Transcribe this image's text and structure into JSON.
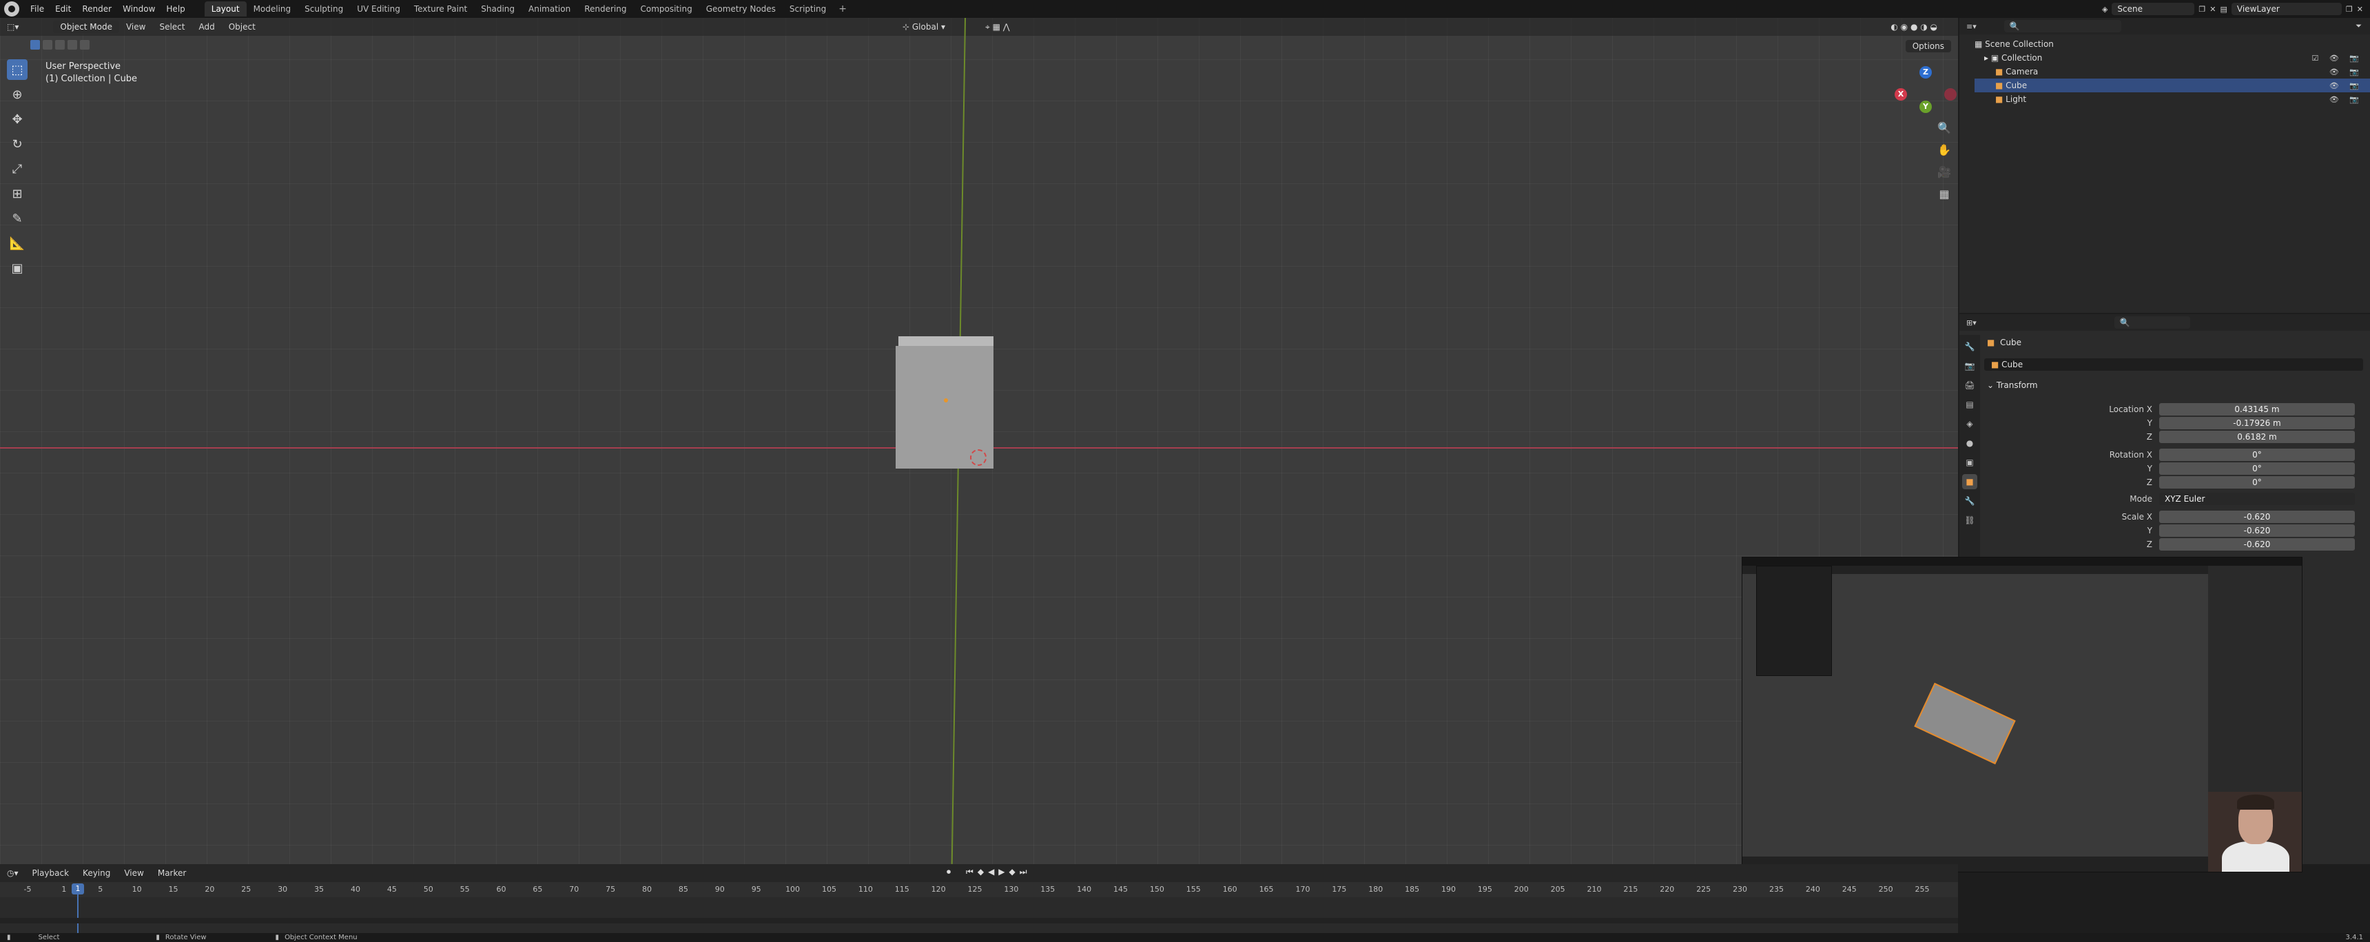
{
  "topbar": {
    "menus": [
      "File",
      "Edit",
      "Render",
      "Window",
      "Help"
    ],
    "workspaces": [
      "Layout",
      "Modeling",
      "Sculpting",
      "UV Editing",
      "Texture Paint",
      "Shading",
      "Animation",
      "Rendering",
      "Compositing",
      "Geometry Nodes",
      "Scripting"
    ],
    "active_workspace": "Layout",
    "scene_label": "Scene",
    "viewlayer_label": "ViewLayer"
  },
  "viewport": {
    "mode": "Object Mode",
    "menus": [
      "View",
      "Select",
      "Add",
      "Object"
    ],
    "orientation": "Global",
    "options_label": "Options",
    "info_line1": "User Perspective",
    "info_line2": "(1) Collection | Cube"
  },
  "outliner": {
    "root": "Scene Collection",
    "collection": "Collection",
    "items": [
      "Camera",
      "Cube",
      "Light"
    ]
  },
  "properties": {
    "object_name": "Cube",
    "data_name": "Cube",
    "panel_title": "Transform",
    "location_label": "Location X",
    "location": [
      "0.43145 m",
      "-0.17926 m",
      "0.6182 m"
    ],
    "rotation_label": "Rotation X",
    "rotation": [
      "0°",
      "0°",
      "0°"
    ],
    "mode_label": "Mode",
    "mode_value": "XYZ Euler",
    "scale_label": "Scale X",
    "scale": [
      "-0.620",
      "-0.620",
      "-0.620"
    ],
    "y_label": "Y",
    "z_label": "Z"
  },
  "timeline": {
    "menus": [
      "Playback",
      "Keying",
      "View",
      "Marker"
    ],
    "current_frame": "1",
    "ticks": [
      "-5",
      "1",
      "5",
      "10",
      "15",
      "20",
      "25",
      "30",
      "35",
      "40",
      "45",
      "50",
      "55",
      "60",
      "65",
      "70",
      "75",
      "80",
      "85",
      "90",
      "95",
      "100",
      "105",
      "110",
      "115",
      "120",
      "125",
      "130",
      "135",
      "140",
      "145",
      "150",
      "155",
      "160",
      "165",
      "170",
      "175",
      "180",
      "185",
      "190",
      "195",
      "200",
      "205",
      "210",
      "215",
      "220",
      "225",
      "230",
      "235",
      "240",
      "245",
      "250",
      "255"
    ]
  },
  "statusbar": {
    "select": "Select",
    "rotate": "Rotate View",
    "context": "Object Context Menu",
    "version": "3.4.1"
  }
}
